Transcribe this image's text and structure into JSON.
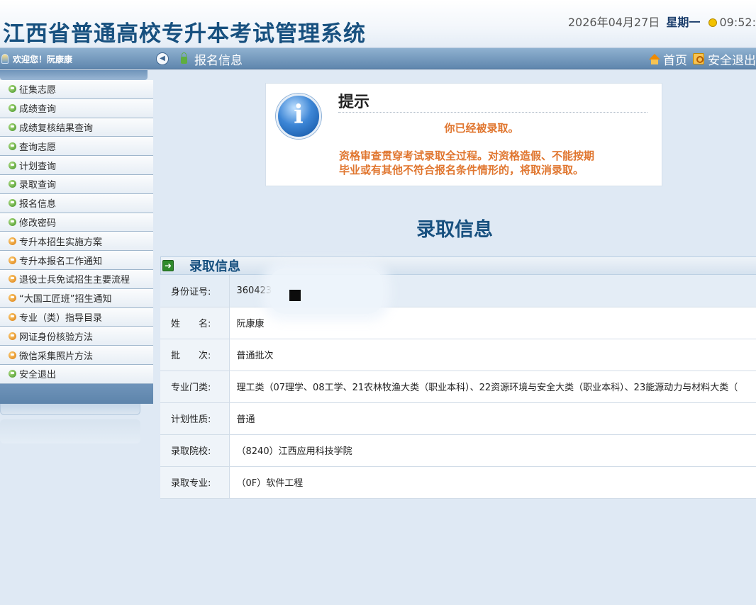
{
  "header": {
    "title": "江西省普通高校专升本考试管理系统",
    "date": "2026年04月27日",
    "weekday": "星期一",
    "time": "09:52:"
  },
  "topbar": {
    "welcome": "欢迎您！阮康康",
    "breadcrumb": "报名信息",
    "home_label": "首页",
    "logout_label": "安全退出"
  },
  "sidebar": {
    "items": [
      {
        "label": "征集志愿",
        "icon": "green"
      },
      {
        "label": "成绩查询",
        "icon": "green"
      },
      {
        "label": "成绩复核结果查询",
        "icon": "green"
      },
      {
        "label": "查询志愿",
        "icon": "green"
      },
      {
        "label": "计划查询",
        "icon": "green"
      },
      {
        "label": "录取查询",
        "icon": "green"
      },
      {
        "label": "报名信息",
        "icon": "green"
      },
      {
        "label": "修改密码",
        "icon": "green"
      },
      {
        "label": "专升本招生实施方案",
        "icon": "orange"
      },
      {
        "label": "专升本报名工作通知",
        "icon": "orange"
      },
      {
        "label": "退役士兵免试招生主要流程",
        "icon": "orange"
      },
      {
        "label": "“大国工匠班”招生通知",
        "icon": "orange"
      },
      {
        "label": "专业（类）指导目录",
        "icon": "orange"
      },
      {
        "label": "网证身份核验方法",
        "icon": "orange"
      },
      {
        "label": "微信采集照片方法",
        "icon": "orange"
      },
      {
        "label": "安全退出",
        "icon": "green"
      }
    ]
  },
  "notice": {
    "title": "提示",
    "message": "你已经被录取。",
    "warning_line1": "资格审查贯穿考试录取全过程。对资格造假、不能按期",
    "warning_line2": "毕业或有其他不符合报名条件情形的，将取消录取。"
  },
  "main": {
    "heading": "录取信息",
    "panel_title": "录取信息",
    "rows": [
      {
        "label": "身份证号:",
        "value": "360423"
      },
      {
        "label": "姓　　名:",
        "value": "阮康康"
      },
      {
        "label": "批　　次:",
        "value": "普通批次"
      },
      {
        "label": "专业门类:",
        "value": "理工类（07理学、08工学、21农林牧渔大类（职业本科）、22资源环境与安全大类（职业本科）、23能源动力与材料大类（"
      },
      {
        "label": "计划性质:",
        "value": "普通"
      },
      {
        "label": "录取院校:",
        "value": "（8240）江西应用科技学院"
      },
      {
        "label": "录取专业:",
        "value": "（0F）软件工程"
      }
    ]
  },
  "colors": {
    "title_blue": "#17507f",
    "notice_orange": "#e0762f",
    "bar_blue": "#6f94ba"
  }
}
